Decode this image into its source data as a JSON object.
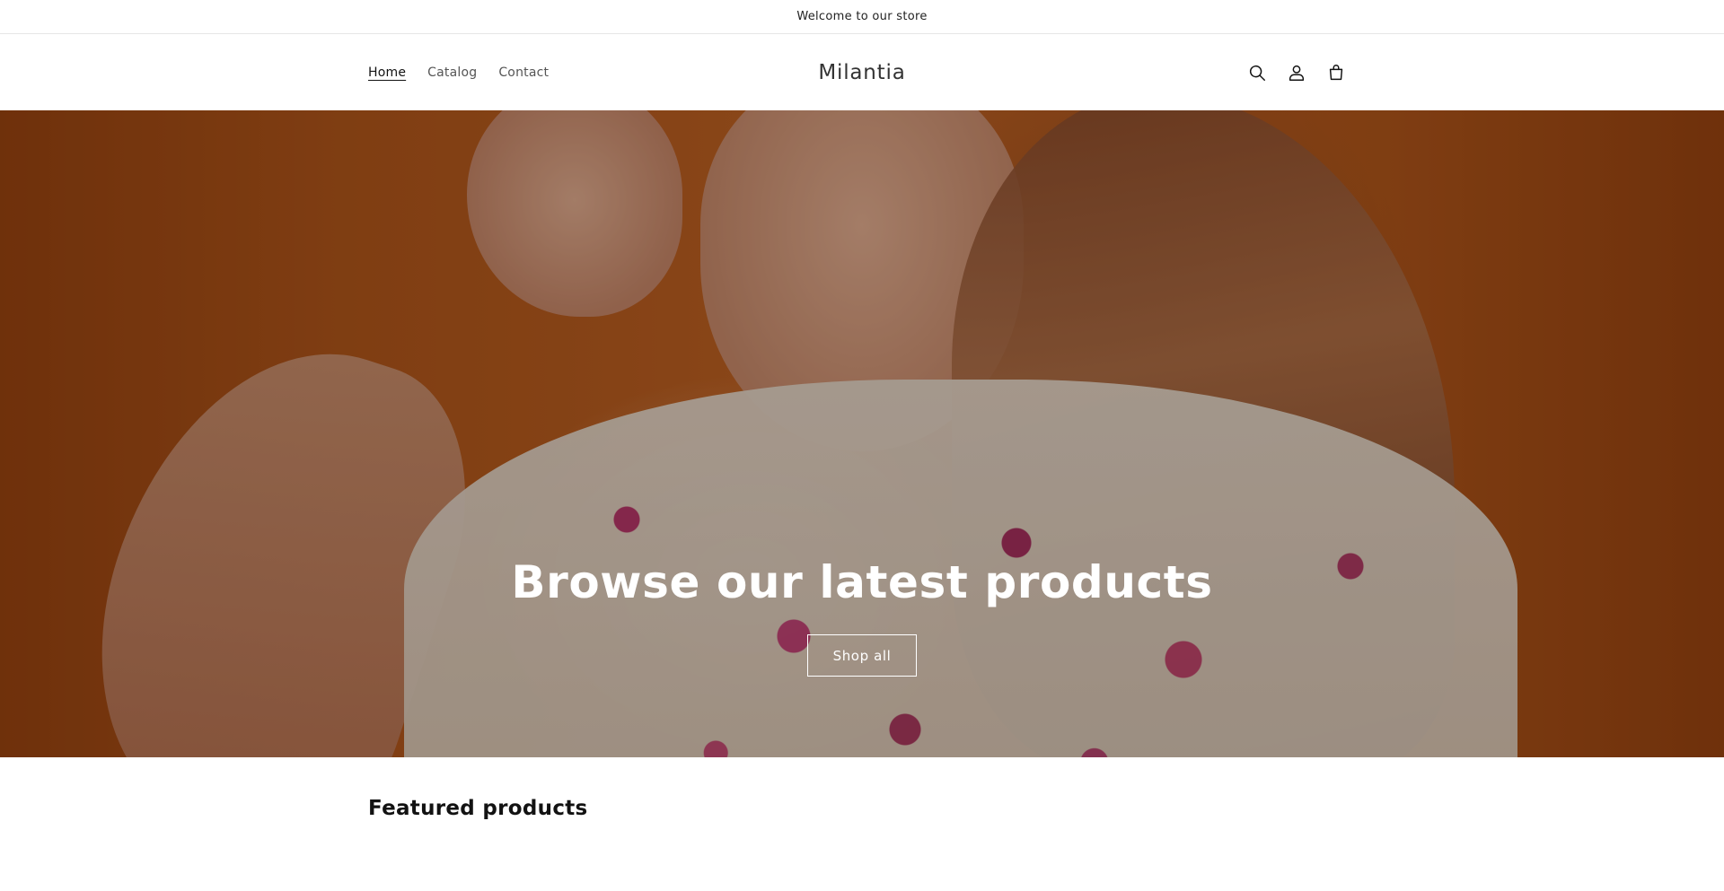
{
  "announcement": {
    "text": "Welcome to our store"
  },
  "header": {
    "nav": [
      {
        "label": "Home",
        "active": true
      },
      {
        "label": "Catalog",
        "active": false
      },
      {
        "label": "Contact",
        "active": false
      }
    ],
    "logo": "Milantia",
    "icons": [
      "search-icon",
      "account-icon",
      "cart-icon"
    ]
  },
  "hero": {
    "title": "Browse our latest products",
    "button_label": "Shop all"
  },
  "featured": {
    "heading": "Featured products"
  },
  "colors": {
    "hero_orange": "#c26424",
    "text": "#121212",
    "white": "#ffffff"
  }
}
